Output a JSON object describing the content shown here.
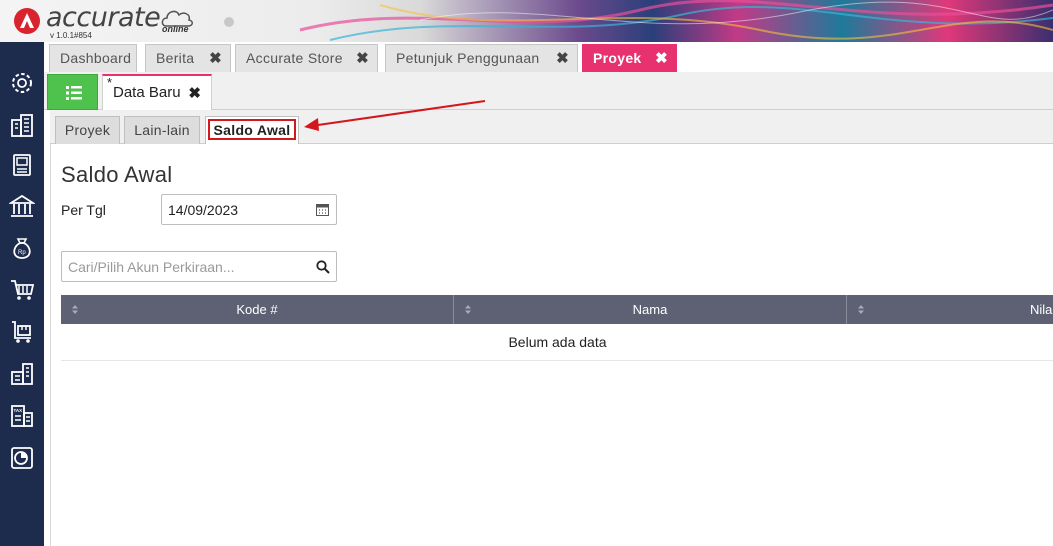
{
  "app": {
    "brand": "accurate",
    "brand_sub": "online",
    "version": "v 1.0.1#854",
    "colors": {
      "accent": "#e8316f",
      "sidebar": "#1d2b4d",
      "menu_green": "#4ec24d",
      "table_header": "#5d6173",
      "highlight": "#d3181d"
    }
  },
  "sidebar": {
    "items": [
      {
        "icon": "gear-icon"
      },
      {
        "icon": "building-icon"
      },
      {
        "icon": "ledger-icon"
      },
      {
        "icon": "bank-icon"
      },
      {
        "icon": "money-bag-icon"
      },
      {
        "icon": "cart-icon"
      },
      {
        "icon": "delivery-cart-icon"
      },
      {
        "icon": "warehouse-icon"
      },
      {
        "icon": "tax-report-icon"
      },
      {
        "icon": "chart-report-icon"
      }
    ]
  },
  "tabs": [
    {
      "label": "Dashboard"
    },
    {
      "label": "Berita",
      "close": "✖"
    },
    {
      "label": "Accurate Store",
      "close": "✖"
    },
    {
      "label": "Petunjuk Penggunaan",
      "close": "✖"
    },
    {
      "label": "Proyek",
      "close": "✖",
      "active": true
    }
  ],
  "document_tab": {
    "modified_mark": "*",
    "label": "Data Baru",
    "close": "✖"
  },
  "subtabs": [
    {
      "label": "Proyek"
    },
    {
      "label": "Lain-lain"
    },
    {
      "label": "Saldo Awal",
      "active": true
    }
  ],
  "form": {
    "title": "Saldo Awal",
    "per_tgl_label": "Per Tgl",
    "date_value": "14/09/2023",
    "search_placeholder": "Cari/Pilih Akun Perkiraan..."
  },
  "table": {
    "columns": [
      "Kode #",
      "Nama",
      "Nilai"
    ],
    "empty_text": "Belum ada data"
  }
}
